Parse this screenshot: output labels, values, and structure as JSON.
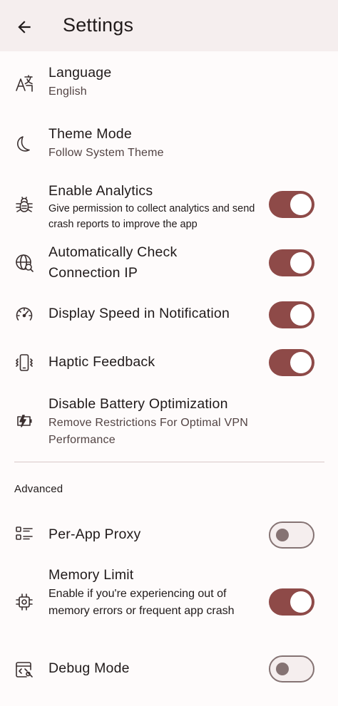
{
  "appbar": {
    "title": "Settings",
    "back_icon": "arrow-back-icon"
  },
  "settings": {
    "language": {
      "label": "Language",
      "value": "English",
      "icon": "translate-icon"
    },
    "theme_mode": {
      "label": "Theme Mode",
      "value": "Follow System Theme",
      "icon": "crescent-moon-icon"
    },
    "analytics": {
      "label": "Enable Analytics",
      "description": "Give permission to collect analytics and send crash reports to improve the app",
      "icon": "bug-icon",
      "enabled": true
    },
    "check_ip": {
      "label": "Automatically Check Connection IP",
      "icon": "globe-search-icon",
      "enabled": true
    },
    "speed_notification": {
      "label": "Display Speed in Notification",
      "icon": "speedometer-icon",
      "enabled": true
    },
    "haptic": {
      "label": "Haptic Feedback",
      "icon": "phone-vibrate-icon",
      "enabled": true
    },
    "battery": {
      "label": "Disable Battery Optimization",
      "description": "Remove Restrictions For Optimal VPN Performance",
      "icon": "battery-saver-icon"
    }
  },
  "advanced": {
    "header": "Advanced",
    "per_app_proxy": {
      "label": "Per-App Proxy",
      "icon": "app-list-icon",
      "enabled": false
    },
    "memory_limit": {
      "label": "Memory Limit",
      "description": "Enable if you're experiencing out of memory errors or frequent app crash",
      "icon": "memory-chip-icon",
      "enabled": true
    },
    "debug_mode": {
      "label": "Debug Mode",
      "icon": "debug-code-icon",
      "enabled": false
    }
  },
  "colors": {
    "accent": "#8e4a48",
    "appbar_bg": "#f5eeee",
    "background": "#fefbfb",
    "switch_off_outline": "#857373"
  }
}
